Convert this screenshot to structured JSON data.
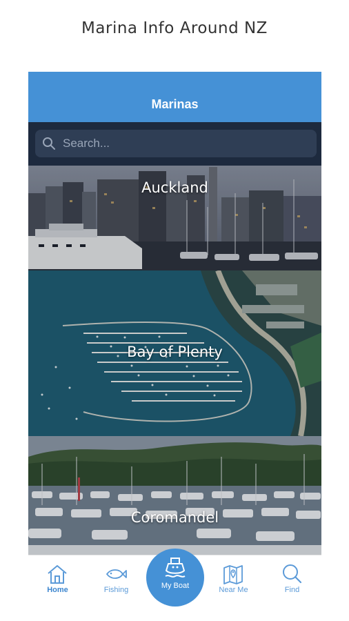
{
  "promo": {
    "title": "Marina Info Around NZ"
  },
  "header": {
    "title": "Marinas"
  },
  "search": {
    "placeholder": "Search...",
    "value": ""
  },
  "regions": [
    {
      "name": "Auckland"
    },
    {
      "name": "Bay of Plenty"
    },
    {
      "name": "Coromandel"
    }
  ],
  "tabs": [
    {
      "label": "Home",
      "icon": "home-icon",
      "active": true
    },
    {
      "label": "Fishing",
      "icon": "fish-icon",
      "active": false
    },
    {
      "label": "My Boat",
      "icon": "boat-icon",
      "active": false
    },
    {
      "label": "Near Me",
      "icon": "map-pin-icon",
      "active": false
    },
    {
      "label": "Find",
      "icon": "search-icon",
      "active": false
    }
  ],
  "colors": {
    "accent": "#4591d6",
    "search_bar_bg": "#1d2a3e",
    "tab_label": "#5b9ad8"
  }
}
